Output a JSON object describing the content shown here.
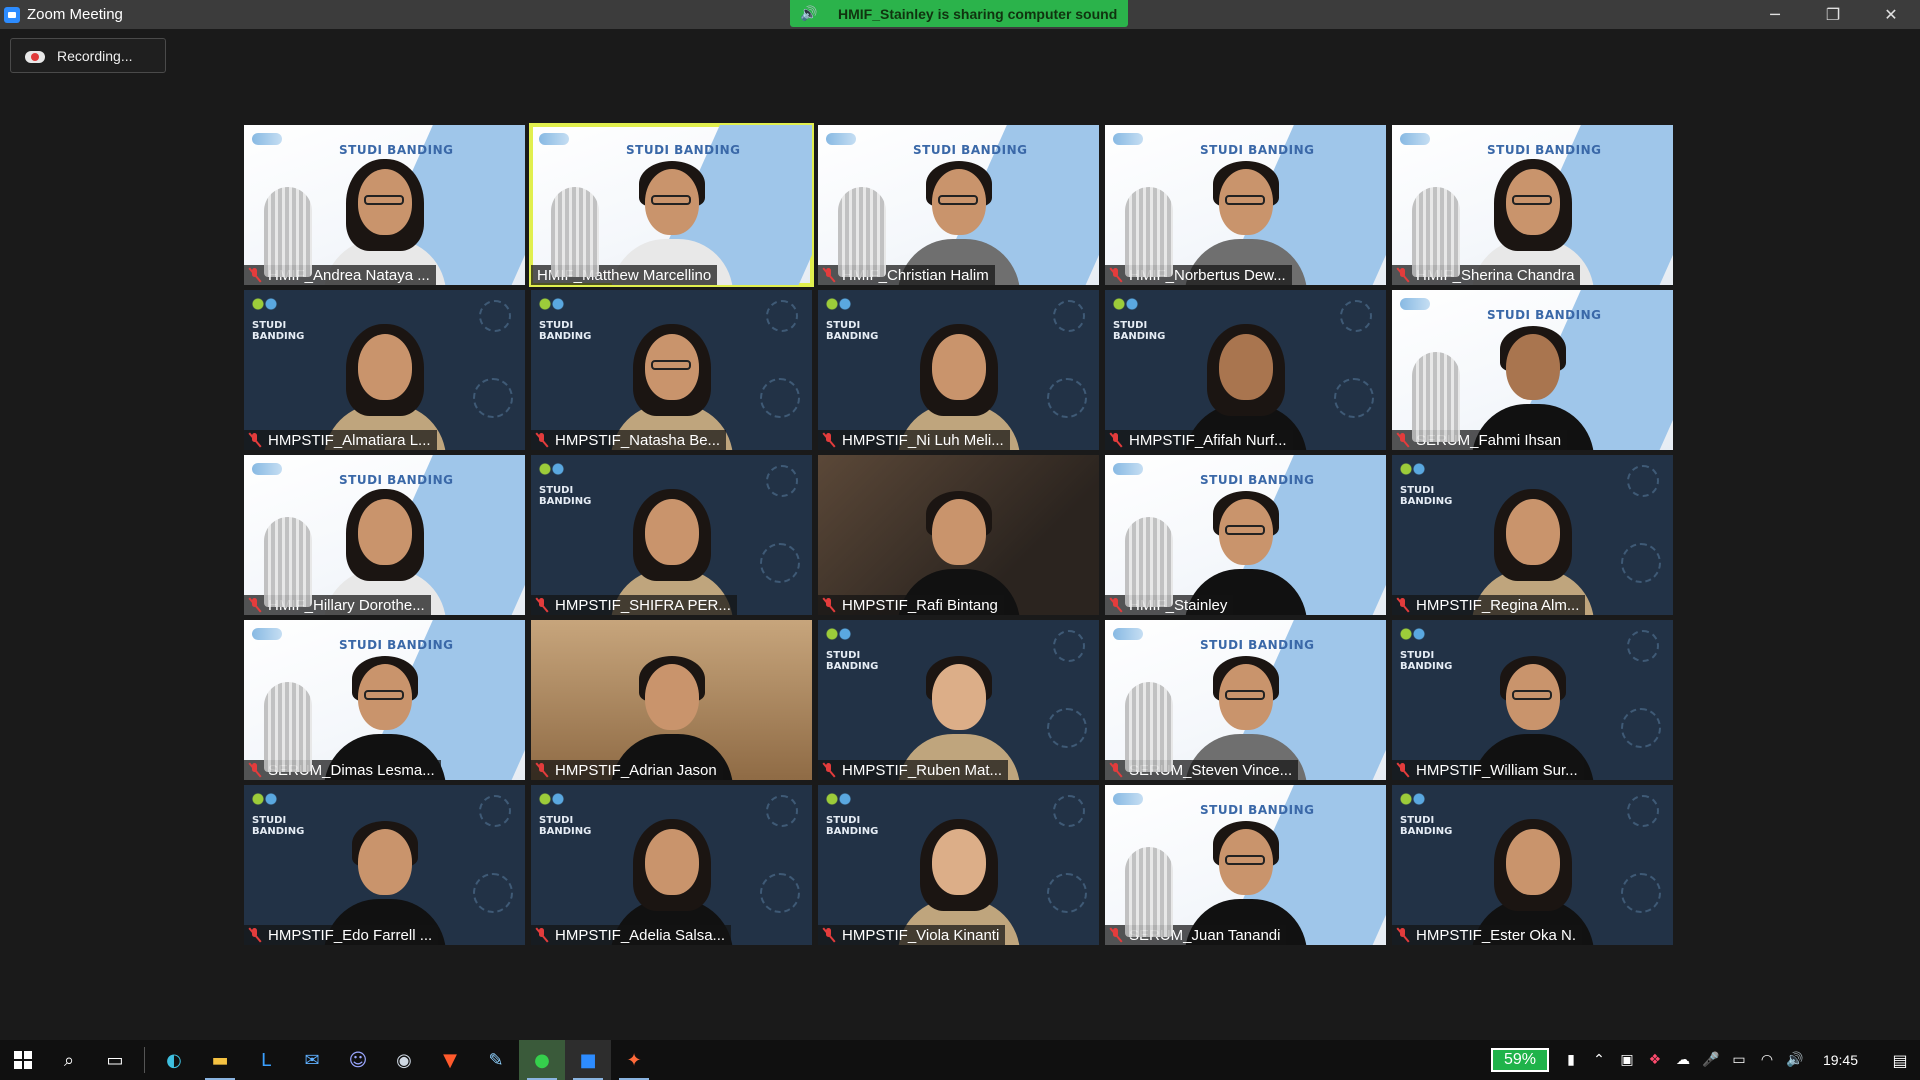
{
  "window": {
    "title": "Zoom Meeting",
    "controls": {
      "minimize": "─",
      "restore": "❐",
      "close": "✕"
    }
  },
  "share_banner": "HMIF_Stainley is sharing computer sound",
  "recording_label": "Recording...",
  "banner_text": "STUDI BANDING",
  "navy_text": "STUDI\nBANDING",
  "participants": [
    {
      "name": "HMIF_Andrea Nataya ...",
      "bg": "white"
    },
    {
      "name": "HMIF_Matthew Marcellino",
      "bg": "white",
      "active": true
    },
    {
      "name": "HMIF_Christian Halim",
      "bg": "white"
    },
    {
      "name": "HMIF_Norbertus Dew...",
      "bg": "white"
    },
    {
      "name": "HMIF_Sherina Chandra",
      "bg": "white"
    },
    {
      "name": "HMPSTIF_Almatiara L...",
      "bg": "navy"
    },
    {
      "name": "HMPSTIF_Natasha Be...",
      "bg": "navy"
    },
    {
      "name": "HMPSTIF_Ni Luh Meli...",
      "bg": "navy"
    },
    {
      "name": "HMPSTIF_Afifah Nurf...",
      "bg": "navy"
    },
    {
      "name": "SERUM_Fahmi Ihsan",
      "bg": "white"
    },
    {
      "name": "HMIF_Hillary Dorothe...",
      "bg": "white"
    },
    {
      "name": "HMPSTIF_SHIFRA PER...",
      "bg": "navy"
    },
    {
      "name": "HMPSTIF_Rafi Bintang",
      "bg": "room"
    },
    {
      "name": "HMIF_Stainley",
      "bg": "white"
    },
    {
      "name": "HMPSTIF_Regina Alm...",
      "bg": "navy"
    },
    {
      "name": "SERUM_Dimas Lesma...",
      "bg": "white"
    },
    {
      "name": "HMPSTIF_Adrian Jason",
      "bg": "warm"
    },
    {
      "name": "HMPSTIF_Ruben Mat...",
      "bg": "navy"
    },
    {
      "name": "SERUM_Steven Vince...",
      "bg": "white"
    },
    {
      "name": "HMPSTIF_William Sur...",
      "bg": "navy"
    },
    {
      "name": "HMPSTIF_Edo Farrell ...",
      "bg": "navy"
    },
    {
      "name": "HMPSTIF_Adelia Salsa...",
      "bg": "navy"
    },
    {
      "name": "HMPSTIF_Viola Kinanti",
      "bg": "navy"
    },
    {
      "name": "SERUM_Juan Tanandi",
      "bg": "white"
    },
    {
      "name": "HMPSTIF_Ester Oka N.",
      "bg": "navy"
    }
  ],
  "taskbar": {
    "apps": [
      "start",
      "search",
      "task-view",
      "edge",
      "file-explorer",
      "app-l",
      "mail",
      "discord",
      "steam",
      "brave",
      "notepad",
      "line",
      "zoom",
      "paint"
    ],
    "battery": "59%",
    "time": "19:45"
  },
  "colors": {
    "accent_active": "#e1ef4e",
    "share_green": "#2bb34b",
    "mute_red": "#e33c3c",
    "battery_green": "#1fb34a"
  }
}
